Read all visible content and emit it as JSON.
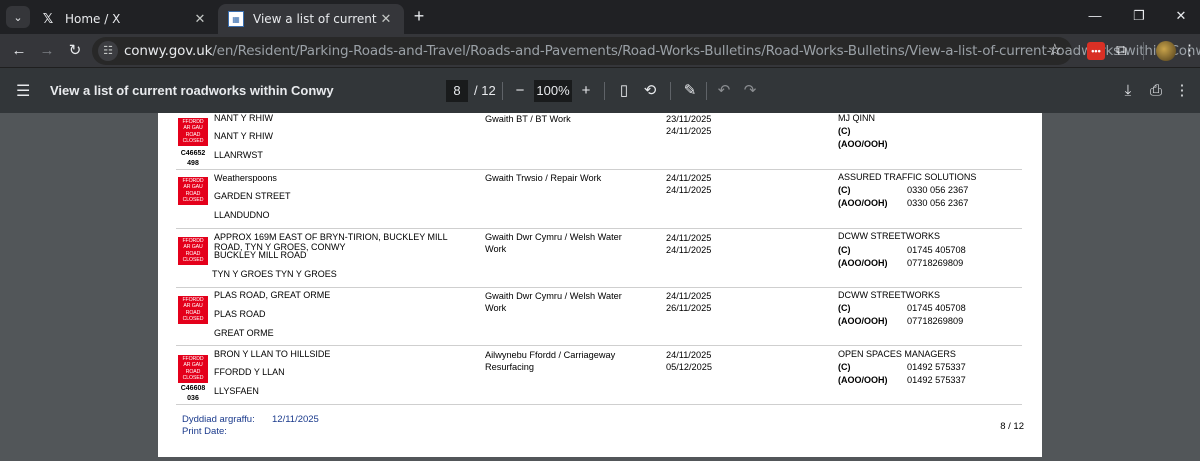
{
  "browser": {
    "tabs": [
      {
        "title": "Home / X",
        "icon": "x-logo-icon"
      },
      {
        "title": "View a list of current roadworks",
        "icon": "conwy-favicon"
      }
    ],
    "url_host": "conwy.gov.uk",
    "url_path": "/en/Resident/Parking-Roads-and-Travel/Roads-and-Pavements/Road-Works-Bulletins/Road-Works-Bulletins/View-a-list-of-current-roadworks-within-Conwy.pdf"
  },
  "pdf_toolbar": {
    "title": "View a list of current roadworks within Conwy",
    "current_page": "8",
    "total_pages": "/ 12",
    "zoom": "100%"
  },
  "badge_text": [
    "FFORDD",
    "AR GAU",
    "ROAD",
    "CLOSED"
  ],
  "rows": [
    {
      "loc1": "NANT Y RHIW",
      "loc2": "NANT Y RHIW",
      "loc3": "LLANRWST",
      "ref": "C46652 498",
      "work": "Gwaith BT / BT Work",
      "start": "23/11/2025",
      "end": "24/11/2025",
      "contractor": "MJ QINN",
      "c_label": "(C)",
      "c_phone": "",
      "ooh_label": "(AOO/OOH)",
      "ooh_phone": ""
    },
    {
      "loc1": "Weatherspoons",
      "loc2": "GARDEN STREET",
      "loc3": "LLANDUDNO",
      "ref": "",
      "work": "Gwaith Trwsio / Repair Work",
      "start": "24/11/2025",
      "end": "24/11/2025",
      "contractor": "ASSURED TRAFFIC SOLUTIONS",
      "c_label": "(C)",
      "c_phone": "0330 056 2367",
      "ooh_label": "(AOO/OOH)",
      "ooh_phone": "0330 056 2367"
    },
    {
      "loc1": "APPROX 169M EAST OF BRYN-TIRION, BUCKLEY MILL ROAD, TYN Y GROES, CONWY",
      "loc2": "BUCKLEY MILL ROAD",
      "loc3": "TYN Y GROES TYN Y GROES",
      "ref": "",
      "work": "Gwaith Dwr Cymru / Welsh Water Work",
      "start": "24/11/2025",
      "end": "24/11/2025",
      "contractor": "DCWW STREETWORKS",
      "c_label": "(C)",
      "c_phone": "01745 405708",
      "ooh_label": "(AOO/OOH)",
      "ooh_phone": "07718269809"
    },
    {
      "loc1": "PLAS ROAD, GREAT ORME",
      "loc2": "PLAS ROAD",
      "loc3": "GREAT ORME",
      "ref": "",
      "work": "Gwaith Dwr Cymru / Welsh Water Work",
      "start": "24/11/2025",
      "end": "26/11/2025",
      "contractor": "DCWW STREETWORKS",
      "c_label": "(C)",
      "c_phone": "01745 405708",
      "ooh_label": "(AOO/OOH)",
      "ooh_phone": "07718269809"
    },
    {
      "loc1": "BRON Y LLAN TO HILLSIDE",
      "loc2": "FFORDD Y LLAN",
      "loc3": "LLYSFAEN",
      "ref": "C46608 036",
      "work": "Ailwynebu Ffordd / Carriageway Resurfacing",
      "start": "24/11/2025",
      "end": "05/12/2025",
      "contractor": "OPEN SPACES MANAGERS",
      "c_label": "(C)",
      "c_phone": "01492 575337",
      "ooh_label": "(AOO/OOH)",
      "ooh_phone": "01492 575337"
    }
  ],
  "footer": {
    "print_label_cy": "Dyddiad argraffu:",
    "print_label_en": "Print Date:",
    "print_date": "12/11/2025",
    "page_number": "8 / 12"
  }
}
